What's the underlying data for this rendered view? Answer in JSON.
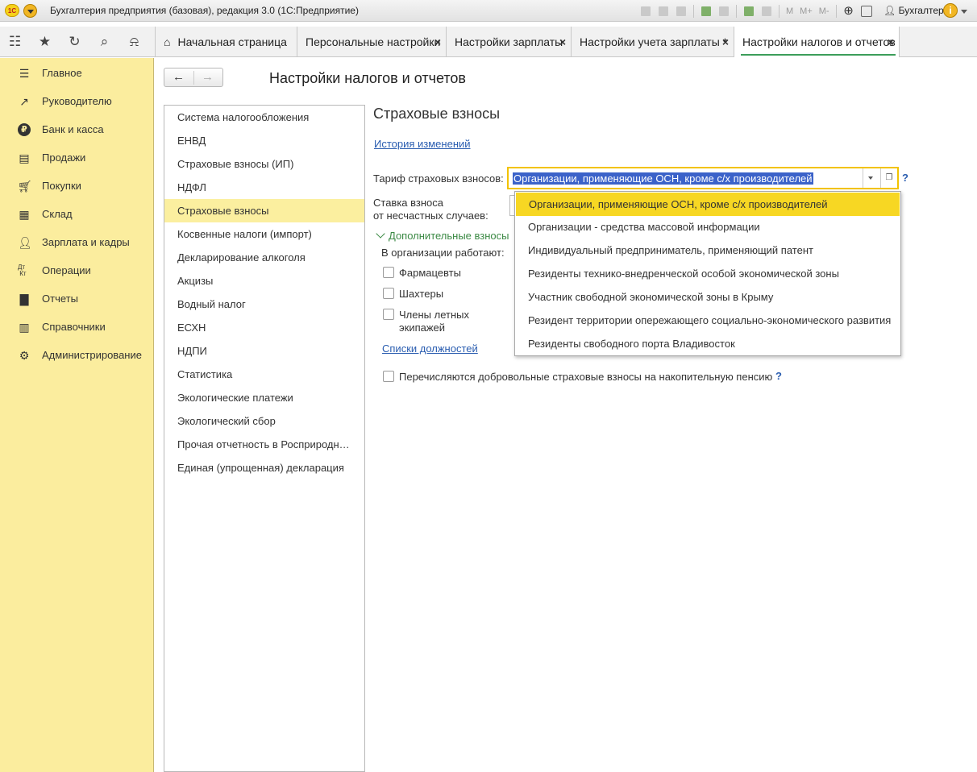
{
  "window": {
    "logo_text": "1С",
    "title": "Бухгалтерия предприятия (базовая), редакция 3.0  (1С:Предприятие)",
    "toolbar_labels": [
      "M",
      "M+",
      "M-"
    ],
    "user": "Бухгалтер",
    "info_label": "i"
  },
  "quick_icons": [
    "apps-grid-icon",
    "star-icon",
    "history-icon",
    "search-icon",
    "bell-icon"
  ],
  "tabs": [
    {
      "label": "Начальная страница",
      "closable": false,
      "active": false
    },
    {
      "label": "Персональные настройки",
      "closable": true,
      "active": false
    },
    {
      "label": "Настройки зарплаты",
      "closable": true,
      "active": false
    },
    {
      "label": "Настройки учета зарплаты *",
      "closable": true,
      "active": false
    },
    {
      "label": "Настройки налогов и отчетов",
      "closable": true,
      "active": true
    }
  ],
  "sidebar": {
    "items": [
      {
        "label": "Главное",
        "icon": "menu-icon"
      },
      {
        "label": "Руководителю",
        "icon": "trend-icon"
      },
      {
        "label": "Банк и касса",
        "icon": "ruble-icon"
      },
      {
        "label": "Продажи",
        "icon": "bag-icon"
      },
      {
        "label": "Покупки",
        "icon": "cart-icon"
      },
      {
        "label": "Склад",
        "icon": "warehouse-icon"
      },
      {
        "label": "Зарплата и кадры",
        "icon": "person-icon"
      },
      {
        "label": "Операции",
        "icon": "dt-kt-icon"
      },
      {
        "label": "Отчеты",
        "icon": "bar-chart-icon"
      },
      {
        "label": "Справочники",
        "icon": "book-icon"
      },
      {
        "label": "Администрирование",
        "icon": "gear-icon"
      }
    ]
  },
  "page": {
    "title": "Настройки налогов и отчетов",
    "close_glyph": "×"
  },
  "sections": [
    "Система налогообложения",
    "ЕНВД",
    "Страховые взносы (ИП)",
    "НДФЛ",
    "Страховые взносы",
    "Косвенные налоги (импорт)",
    "Декларирование алкоголя",
    "Акцизы",
    "Водный налог",
    "ЕСХН",
    "НДПИ",
    "Статистика",
    "Экологические платежи",
    "Экологический сбор",
    "Прочая отчетность в Росприродн…",
    "Единая (упрощенная) декларация"
  ],
  "selected_section": "Страховые взносы",
  "form": {
    "title": "Страховые взносы",
    "history_link": "История изменений",
    "tariff_label": "Тариф страховых взносов:",
    "tariff_value": "Организации, применяющие ОСН, кроме с/х производителей",
    "help": "?",
    "rate_label_1": "Ставка взноса",
    "rate_label_2": "от несчастных случаев:",
    "additional_group": "Дополнительные взносы",
    "works_label": "В организации работают:",
    "cb_pharmacists": "Фармацевты",
    "cb_miners": "Шахтеры",
    "cb_flight_crew_1": "Члены летных",
    "cb_flight_crew_2": "экипажей",
    "positions_link": "Списки должностей",
    "voluntary_label": "Перечисляются добровольные страховые взносы на накопительную пенсию",
    "voluntary_help": "?"
  },
  "dropdown": {
    "options": [
      "Организации, применяющие ОСН, кроме с/х производителей",
      "Организации - средства массовой информации",
      "Индивидуальный предприниматель, применяющий патент",
      "Резиденты технико-внедренческой особой экономической зоны",
      "Участник свободной экономической зоны в Крыму",
      "Резидент территории опережающего социально-экономического развития",
      "Резиденты свободного порта Владивосток"
    ],
    "highlighted": "Организации, применяющие ОСН, кроме с/х производителей"
  },
  "colors": {
    "sidebar_bg": "#fbed9e",
    "selection": "#fbef9f",
    "highlight": "#f7d723",
    "link": "#2a5db0",
    "group_green": "#3c8a45",
    "text_selection": "#3b62c9"
  }
}
